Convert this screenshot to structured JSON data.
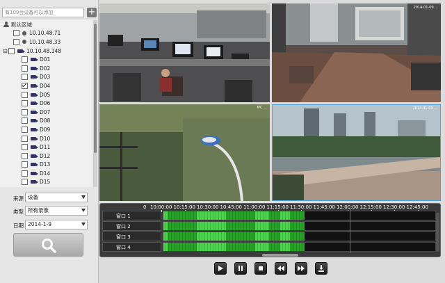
{
  "sidebar": {
    "add_placeholder": "有109台设备可以添加",
    "add_button": "+",
    "tree": {
      "root": "默认区域",
      "devices": [
        {
          "ip": "10.10.48.71",
          "expanded": false
        },
        {
          "ip": "10.10.48.33",
          "expanded": false
        },
        {
          "ip": "10.10.48.148",
          "expanded": true
        }
      ],
      "channels": [
        {
          "label": "D01",
          "checked": false
        },
        {
          "label": "D02",
          "checked": false
        },
        {
          "label": "D03",
          "checked": false
        },
        {
          "label": "D04",
          "checked": true
        },
        {
          "label": "D05",
          "checked": false
        },
        {
          "label": "D06",
          "checked": false
        },
        {
          "label": "D07",
          "checked": false
        },
        {
          "label": "D08",
          "checked": false
        },
        {
          "label": "D09",
          "checked": false
        },
        {
          "label": "D10",
          "checked": false
        },
        {
          "label": "D11",
          "checked": false
        },
        {
          "label": "D12",
          "checked": false
        },
        {
          "label": "D13",
          "checked": false
        },
        {
          "label": "D14",
          "checked": false
        },
        {
          "label": "D15",
          "checked": false
        }
      ]
    },
    "filters": {
      "source_label": "来源",
      "source_value": "设备",
      "type_label": "类型",
      "type_value": "所有录像",
      "date_label": "日期",
      "date_value": "2014-1-9"
    }
  },
  "video": {
    "cam2_overlay": "2014-01-09 ...",
    "cam3_overlay": "IPC ...",
    "cam4_overlay": "2014-01-09 ..."
  },
  "timeline": {
    "start_label": "0",
    "ticks": [
      "10:00:00",
      "10:15:00",
      "10:30:00",
      "10:45:00",
      "11:00:00",
      "11:15:00",
      "11:30:00",
      "11:45:00",
      "12:00:00",
      "12:15:00",
      "12:30:00",
      "12:45:00"
    ],
    "windows": [
      "窗口 1",
      "窗口 2",
      "窗口 3",
      "窗口 4"
    ],
    "recording_color": "#24a424",
    "cursor_color": "#ff3a3a"
  },
  "controls": [
    {
      "name": "play-icon"
    },
    {
      "name": "pause-icon"
    },
    {
      "name": "stop-icon"
    },
    {
      "name": "rewind-icon"
    },
    {
      "name": "fast-forward-icon"
    },
    {
      "name": "download-icon"
    }
  ]
}
